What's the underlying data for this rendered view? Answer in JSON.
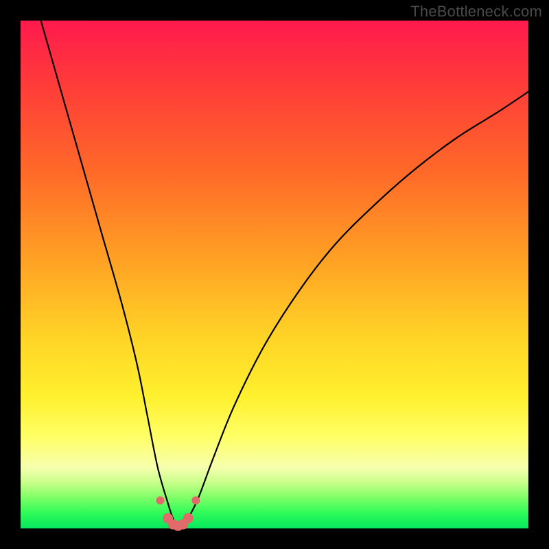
{
  "watermark": "TheBottleneck.com",
  "chart_data": {
    "type": "line",
    "title": "",
    "xlabel": "",
    "ylabel": "",
    "xlim": [
      0,
      100
    ],
    "ylim": [
      0,
      100
    ],
    "grid": false,
    "legend": null,
    "series": [
      {
        "name": "bottleneck-curve",
        "x": [
          4,
          8,
          12,
          16,
          20,
          23,
          25,
          27,
          29,
          30,
          31,
          32,
          33,
          35,
          38,
          42,
          48,
          55,
          62,
          70,
          78,
          86,
          94,
          100
        ],
        "y": [
          100,
          86,
          72,
          58,
          44,
          32,
          22,
          12,
          5,
          2,
          0.5,
          0.5,
          2,
          6,
          14,
          24,
          36,
          47,
          56,
          64,
          71,
          77,
          82,
          86
        ]
      }
    ],
    "markers": {
      "name": "min-region",
      "x": [
        27.5,
        29.0,
        30.0,
        31.0,
        32.0,
        33.0,
        34.5
      ],
      "y": [
        5.5,
        2.0,
        0.8,
        0.5,
        0.8,
        2.0,
        5.5
      ]
    },
    "background_gradient": {
      "orientation": "vertical",
      "stops": [
        {
          "pos": 0.0,
          "color": "#ff1a4d"
        },
        {
          "pos": 0.3,
          "color": "#ff6a28"
        },
        {
          "pos": 0.62,
          "color": "#ffd326"
        },
        {
          "pos": 0.82,
          "color": "#ffff66"
        },
        {
          "pos": 0.94,
          "color": "#7dff66"
        },
        {
          "pos": 1.0,
          "color": "#07e85e"
        }
      ]
    }
  }
}
